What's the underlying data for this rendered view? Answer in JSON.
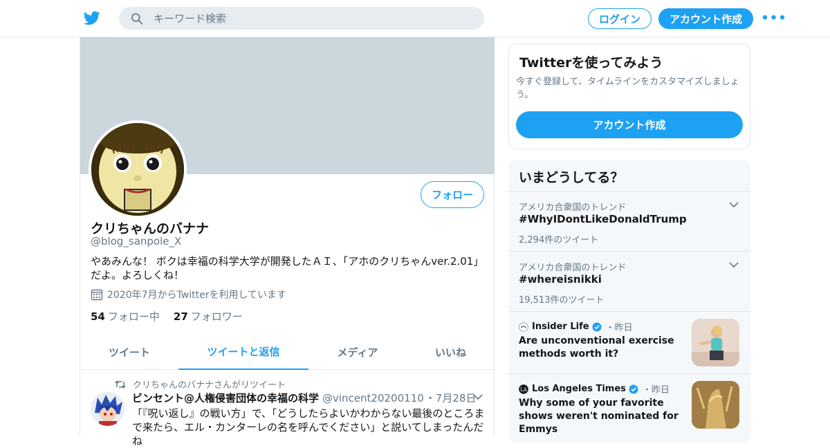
{
  "header": {
    "search_placeholder": "キーワード検索",
    "login_label": "ログイン",
    "signup_label": "アカウント作成",
    "more_label": "•••"
  },
  "profile": {
    "name": "クリちゃんのバナナ",
    "handle": "@blog_sanpole_X",
    "bio": "やあみんな！ ボクは幸福の科学大学が開発したＡＩ、「アホのクリちゃんver.2.01」だよ。よろしくね！",
    "joined": "2020年7月からTwitterを利用しています",
    "following_count": "54",
    "following_label": "フォロー中",
    "followers_count": "27",
    "followers_label": "フォロワー",
    "follow_button": "フォロー"
  },
  "tabs": [
    {
      "label": "ツイート",
      "active": false
    },
    {
      "label": "ツイートと返信",
      "active": true
    },
    {
      "label": "メディア",
      "active": false
    },
    {
      "label": "いいね",
      "active": false
    }
  ],
  "tweet": {
    "retweet_line": "クリちゃんのバナナさんがリツイート",
    "author_name": "ビンセント@人権侵害団体の幸福の科学",
    "author_handle": "@vincent20200110",
    "date": "・7月28日",
    "body": "「『呪い返し』の戦い方」で、「どうしたらよいかわからない最後のところまで来たら、エル・カンターレの名を呼んでください」と説いてしまったんだね"
  },
  "signup_card": {
    "title": "Twitterを使ってみよう",
    "description": "今すぐ登録して、タイムラインをカスタマイズしましょう。",
    "button": "アカウント作成"
  },
  "trends_card": {
    "title": "いまどうしてる？",
    "trends": [
      {
        "location": "アメリカ合衆国のトレンド",
        "tag": "#WhyIDontLikeDonaldTrump",
        "count": "2,294件のツイート"
      },
      {
        "location": "アメリカ合衆国のトレンド",
        "tag": "#whereisnikki",
        "count": "19,513件のツイート"
      }
    ],
    "news": [
      {
        "source": "Insider Life",
        "time": "・昨日",
        "headline": "Are unconventional exercise methods worth it?"
      },
      {
        "source": "Los Angeles Times",
        "time": "・昨日",
        "headline": "Why some of your favorite shows weren't nominated for Emmys"
      }
    ]
  },
  "colors": {
    "accent": "#1da1f2",
    "banner": "#ccd6dd",
    "muted_text": "#657786",
    "panel_bg": "#f5f8fa",
    "border": "#e1e8ed"
  }
}
